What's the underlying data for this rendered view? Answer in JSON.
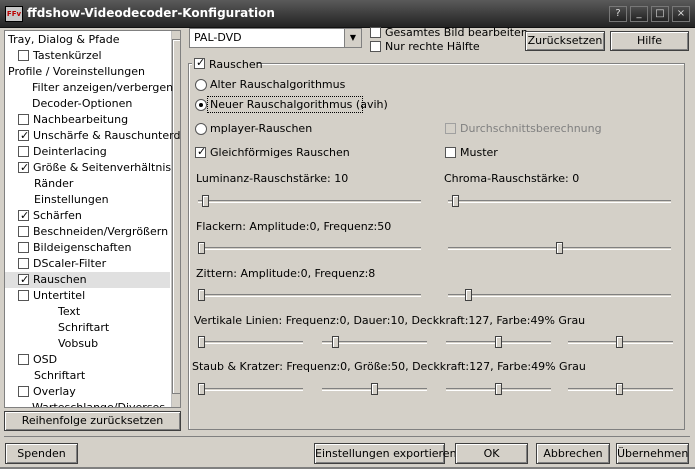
{
  "window": {
    "title": "ffdshow-Videodecoder-Konfiguration",
    "icon_text": "FFv",
    "controls": {
      "help": "?",
      "minimize": "_",
      "maximize": "□",
      "close": "×"
    }
  },
  "tree": {
    "items": [
      {
        "label": "Tray, Dialog & Pfade",
        "checkbox": false,
        "checked": false,
        "indent": 0
      },
      {
        "label": "Tastenkürzel",
        "checkbox": true,
        "checked": false,
        "indent": 1
      },
      {
        "label": "Profile / Voreinstellungen",
        "checkbox": false,
        "checked": false,
        "indent": 0
      },
      {
        "label": "Filter anzeigen/verbergen",
        "checkbox": false,
        "checked": false,
        "indent": 2
      },
      {
        "label": "Decoder-Optionen",
        "checkbox": false,
        "checked": false,
        "indent": 2
      },
      {
        "label": "Nachbearbeitung",
        "checkbox": true,
        "checked": false,
        "indent": 1
      },
      {
        "label": "Unschärfe & Rauschunterdr",
        "checkbox": true,
        "checked": true,
        "indent": 1
      },
      {
        "label": "Deinterlacing",
        "checkbox": true,
        "checked": false,
        "indent": 1
      },
      {
        "label": "Größe & Seitenverhältnis",
        "checkbox": true,
        "checked": true,
        "indent": 1
      },
      {
        "label": "Ränder",
        "checkbox": false,
        "checked": false,
        "indent": 3
      },
      {
        "label": "Einstellungen",
        "checkbox": false,
        "checked": false,
        "indent": 3
      },
      {
        "label": "Schärfen",
        "checkbox": true,
        "checked": true,
        "indent": 1
      },
      {
        "label": "Beschneiden/Vergrößern",
        "checkbox": true,
        "checked": false,
        "indent": 1
      },
      {
        "label": "Bildeigenschaften",
        "checkbox": true,
        "checked": false,
        "indent": 1
      },
      {
        "label": "DScaler-Filter",
        "checkbox": true,
        "checked": false,
        "indent": 1
      },
      {
        "label": "Rauschen",
        "checkbox": true,
        "checked": true,
        "indent": 1,
        "selected": true
      },
      {
        "label": "Untertitel",
        "checkbox": true,
        "checked": false,
        "indent": 1
      },
      {
        "label": "Text",
        "checkbox": false,
        "checked": false,
        "indent": 4
      },
      {
        "label": "Schriftart",
        "checkbox": false,
        "checked": false,
        "indent": 4
      },
      {
        "label": "Vobsub",
        "checkbox": false,
        "checked": false,
        "indent": 4
      },
      {
        "label": "OSD",
        "checkbox": true,
        "checked": false,
        "indent": 1
      },
      {
        "label": "Schriftart",
        "checkbox": false,
        "checked": false,
        "indent": 3
      },
      {
        "label": "Overlay",
        "checkbox": true,
        "checked": false,
        "indent": 1
      },
      {
        "label": "Warteschlange/Diverses",
        "checkbox": false,
        "checked": false,
        "indent": 2
      }
    ],
    "reset_order_button": "Reihenfolge zurücksetzen"
  },
  "top": {
    "preset_value": "PAL-DVD",
    "edit_whole_image": "Gesamtes Bild bearbeiten",
    "right_half_only": "Nur rechte Hälfte",
    "reset_button": "Zurücksetzen",
    "help_button": "Hilfe"
  },
  "noise": {
    "enable_label": "Rauschen",
    "enabled": true,
    "algo_old": "Alter Rauschalgorithmus",
    "algo_new": "Neuer Rauschalgorithmus (avih)",
    "algo_mplayer": "mplayer-Rauschen",
    "selected_algo": "new",
    "averaged": "Durchschnittsberechnung",
    "uniform": "Gleichförmiges Rauschen",
    "uniform_checked": true,
    "pattern": "Muster",
    "pattern_checked": false,
    "luma_label": "Luminanz-Rauschstärke: 10",
    "chroma_label": "Chroma-Rauschstärke: 0",
    "flicker_label": "Flackern: Amplitude:0, Frequenz:50",
    "jitter_label": "Zittern: Amplitude:0, Frequenz:8",
    "vlines_label": "Vertikale Linien: Frequenz:0, Dauer:10, Deckkraft:127, Farbe:49% Grau",
    "scratch_label": "Staub & Kratzer: Frequenz:0, Größe:50, Deckkraft:127, Farbe:49% Grau",
    "sliders": {
      "luma": 0.02,
      "chroma": 0.02,
      "flicker_amp": 0.0,
      "flicker_freq": 0.5,
      "jitter_amp": 0.0,
      "jitter_freq": 0.08,
      "vlines": [
        0.0,
        0.1,
        0.5,
        0.49
      ],
      "scratch": [
        0.0,
        0.5,
        0.5,
        0.49
      ]
    }
  },
  "footer": {
    "donate": "Spenden",
    "export": "Einstellungen exportieren",
    "ok": "OK",
    "cancel": "Abbrechen",
    "apply": "Übernehmen"
  }
}
